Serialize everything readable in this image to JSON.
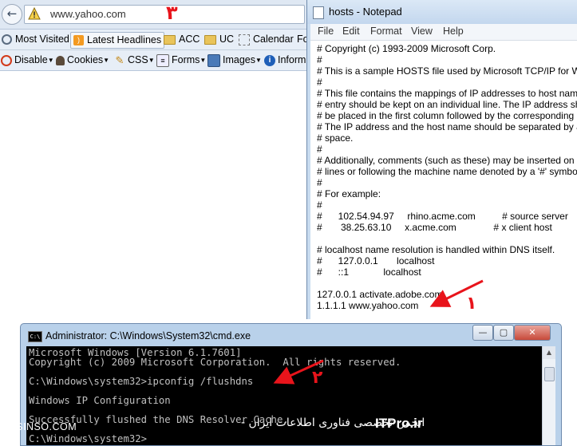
{
  "browser": {
    "back_glyph": "←",
    "url": "www.yahoo.com",
    "bookmarks": [
      "Most Visited",
      "Latest Headlines",
      "ACC",
      "UC",
      "Calendar",
      "Fo"
    ],
    "devbar": [
      "Disable",
      "Cookies",
      "CSS",
      "Forms",
      "Images",
      "Inform"
    ]
  },
  "notepad": {
    "title": "hosts - Notepad",
    "menu": [
      "File",
      "Edit",
      "Format",
      "View",
      "Help"
    ],
    "lines": [
      "# Copyright (c) 1993-2009 Microsoft Corp.",
      "#",
      "# This is a sample HOSTS file used by Microsoft TCP/IP for Windows.",
      "#",
      "# This file contains the mappings of IP addresses to host names. Each",
      "# entry should be kept on an individual line. The IP address should",
      "# be placed in the first column followed by the corresponding host name.",
      "# The IP address and the host name should be separated by at least one",
      "# space.",
      "#",
      "# Additionally, comments (such as these) may be inserted on individual",
      "# lines or following the machine name denoted by a '#' symbol.",
      "#",
      "# For example:",
      "#",
      "#      102.54.94.97     rhino.acme.com          # source server",
      "#       38.25.63.10     x.acme.com              # x client host",
      "",
      "# localhost name resolution is handled within DNS itself.",
      "#\t127.0.0.1       localhost",
      "#\t::1             localhost",
      "",
      "127.0.0.1 activate.adobe.com",
      "1.1.1.1 www.yahoo.com"
    ]
  },
  "cmd": {
    "title": "Administrator: C:\\Windows\\System32\\cmd.exe",
    "min_glyph": "—",
    "max_glyph": "▢",
    "close_glyph": "✕",
    "lines": [
      "Microsoft Windows [Version 6.1.7601]",
      "Copyright (c) 2009 Microsoft Corporation.  All rights reserved.",
      "",
      "C:\\Windows\\system32>ipconfig /flushdns",
      "",
      "Windows IP Configuration",
      "",
      "Successfully flushed the DNS Resolver Cache.",
      "C:\\Windows\\system32>"
    ]
  },
  "annotations": {
    "step1": "۱",
    "step2": "۲",
    "step3": "۳",
    "color": "#e8141b"
  },
  "watermark": {
    "brand": "ITPro.ir",
    "persian": "انجمن تخصصی فناوری اطلاعات ایران -",
    "site": "TOSINSO.COM"
  }
}
